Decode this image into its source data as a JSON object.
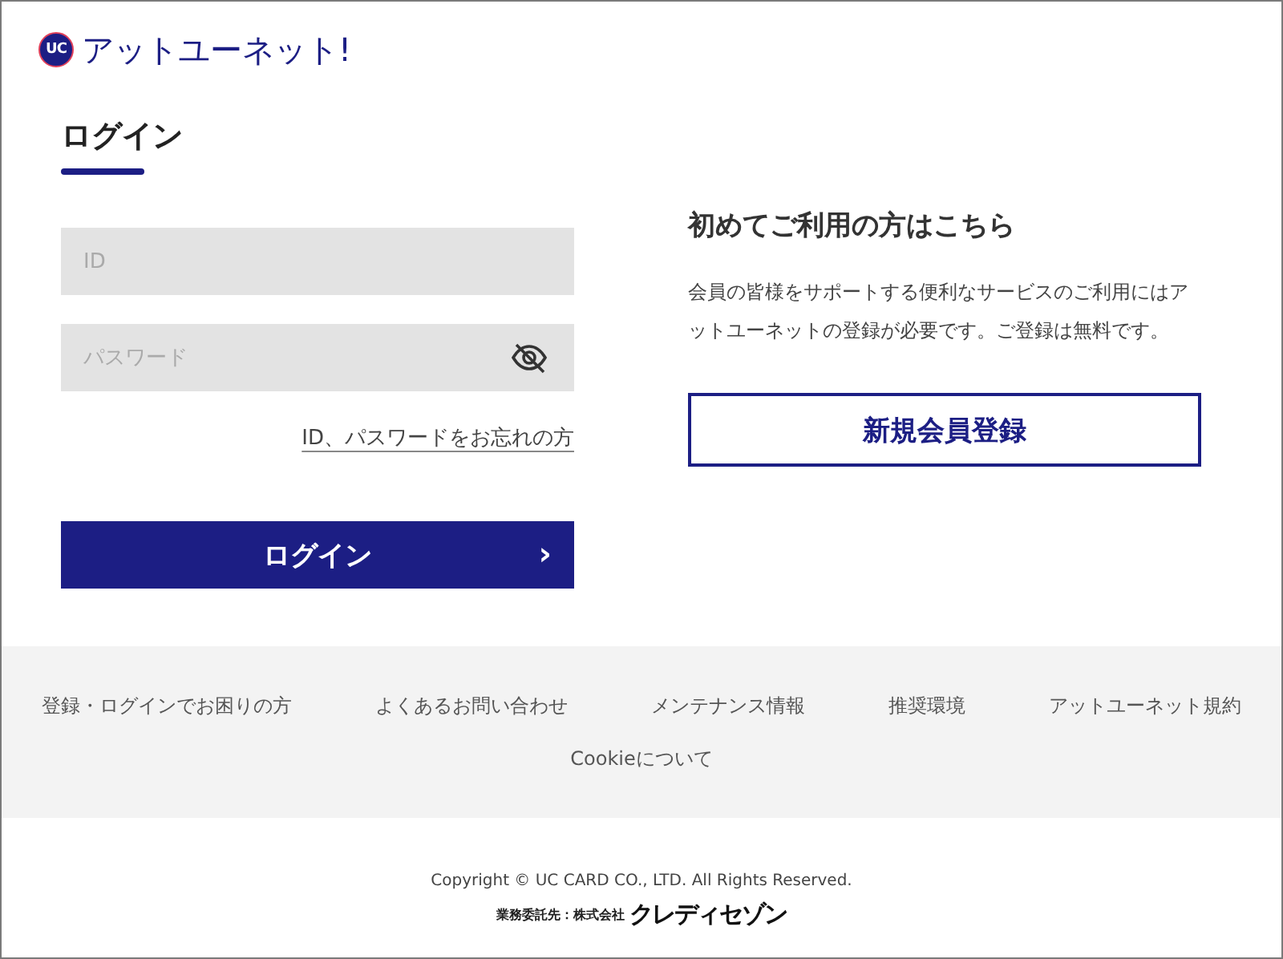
{
  "header": {
    "logo_mark": "UC",
    "logo_text": "アットユーネット!"
  },
  "login": {
    "title": "ログイン",
    "id_field": {
      "placeholder": "ID"
    },
    "password_field": {
      "placeholder": "パスワード"
    },
    "forgot_link": "ID、パスワードをお忘れの方",
    "submit": {
      "label": "ログイン",
      "arrow": "›"
    }
  },
  "register": {
    "heading": "初めてご利用の方はこちら",
    "description": "会員の皆様をサポートする便利なサービスのご利用にはアットユーネットの登録が必要です。ご登録は無料です。",
    "button": "新規会員登録"
  },
  "footer_links": [
    "登録・ログインでお困りの方",
    "よくあるお問い合わせ",
    "メンテナンス情報",
    "推奨環境",
    "アットユーネット規約",
    "Cookieについて"
  ],
  "copyright": "Copyright © UC CARD CO., LTD. All Rights Reserved.",
  "entrusted": {
    "label": "業務委託先：株式会社",
    "company": "クレディセゾン"
  }
}
